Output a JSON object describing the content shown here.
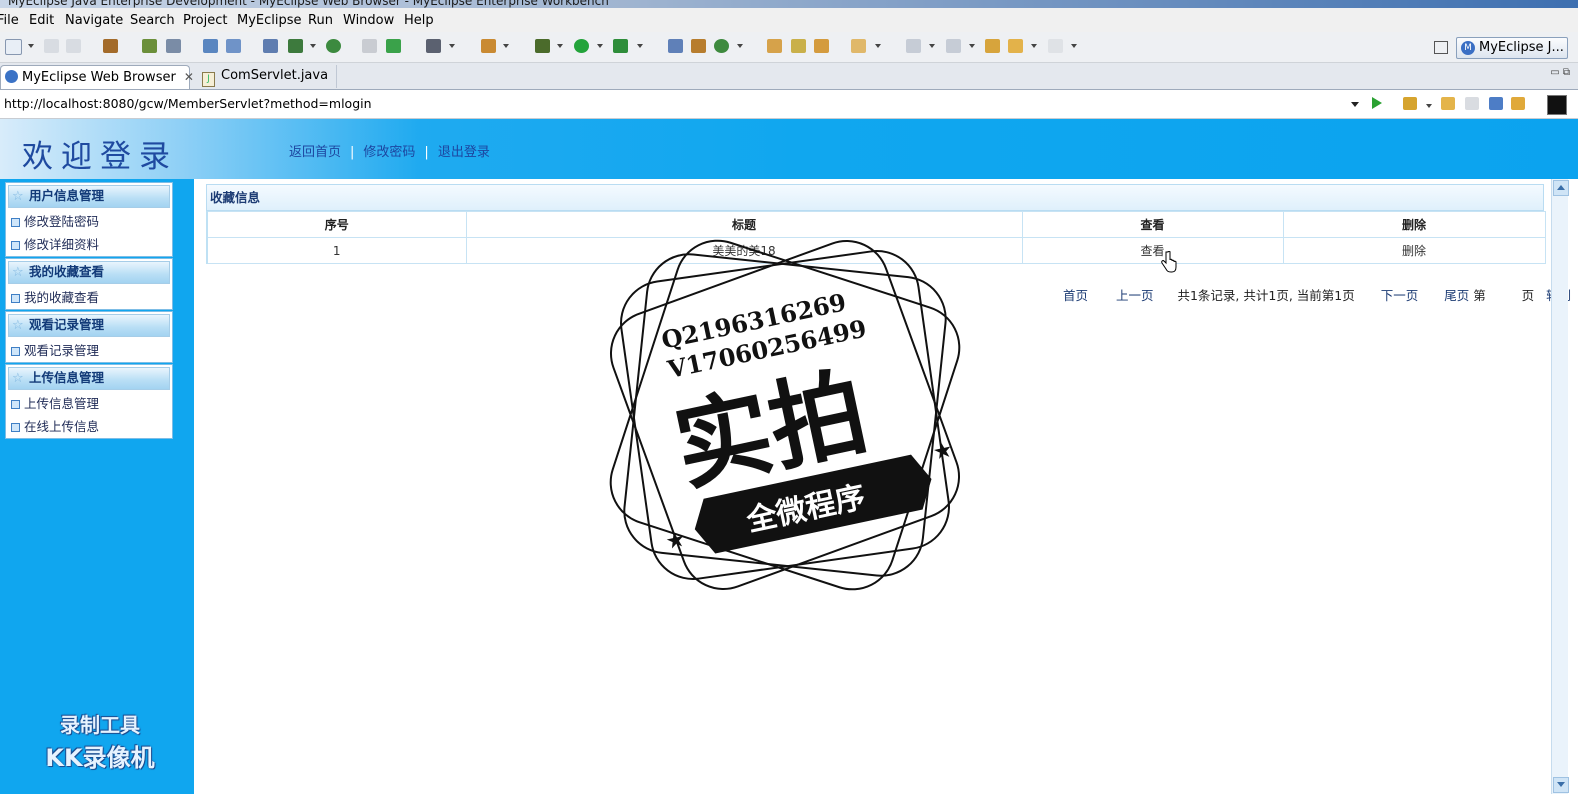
{
  "window": {
    "title": "MyEclipse Java Enterprise Development - MyEclipse Web Browser - MyEclipse Enterprise Workbench"
  },
  "menu": [
    "File",
    "Edit",
    "Navigate",
    "Search",
    "Project",
    "MyEclipse",
    "Run",
    "Window",
    "Help"
  ],
  "perspective": {
    "label": "MyEclipse J..."
  },
  "editor_tabs": [
    {
      "label": "MyEclipse Web Browser",
      "active": true
    },
    {
      "label": "ComServlet.java",
      "active": false
    }
  ],
  "browser": {
    "url": "http://localhost:8080/gcw/MemberServlet?method=mlogin"
  },
  "page": {
    "title": "欢迎登录",
    "top_nav": [
      "返回首页",
      "修改密码",
      "退出登录"
    ],
    "sidebar": [
      {
        "title": "用户信息管理",
        "items": [
          "修改登陆密码",
          "修改详细资料"
        ]
      },
      {
        "title": "我的收藏查看",
        "items": [
          "我的收藏查看"
        ]
      },
      {
        "title": "观看记录管理",
        "items": [
          "观看记录管理"
        ]
      },
      {
        "title": "上传信息管理",
        "items": [
          "上传信息管理",
          "在线上传信息"
        ]
      }
    ],
    "watermark": {
      "line1": "录制工具",
      "line2": "KK录像机"
    },
    "panel_title": "收藏信息",
    "table": {
      "columns": [
        "序号",
        "标题",
        "查看",
        "删除"
      ],
      "rows": [
        [
          "1",
          "美美的美18",
          "查看",
          "删除"
        ]
      ]
    },
    "pager": {
      "first": "首页",
      "prev": "上一页",
      "summary": "共1条记录, 共计1页, 当前第1页",
      "next": "下一页",
      "last": "尾页",
      "goto_prefix": "第",
      "goto_suffix": "页",
      "goto": "转到"
    }
  },
  "stamp": {
    "line1": "Q2196316269",
    "line2": "V17060256499",
    "big": "实拍",
    "banner": "全微程序"
  },
  "colors": {
    "header_blue": "#10a7ef",
    "title_blue": "#1f4aa0",
    "link_blue": "#1d46a0"
  }
}
